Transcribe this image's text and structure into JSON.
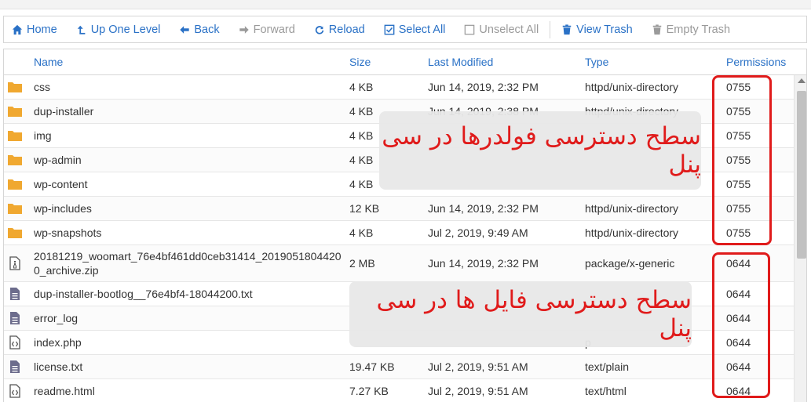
{
  "toolbar": {
    "home": "Home",
    "up_one_level": "Up One Level",
    "back": "Back",
    "forward": "Forward",
    "reload": "Reload",
    "select_all": "Select All",
    "unselect_all": "Unselect All",
    "view_trash": "View Trash",
    "empty_trash": "Empty Trash"
  },
  "columns": {
    "name": "Name",
    "size": "Size",
    "last_modified": "Last Modified",
    "type": "Type",
    "permissions": "Permissions"
  },
  "rows": [
    {
      "icon": "folder-icon",
      "name": "css",
      "size": "4 KB",
      "modified": "Jun 14, 2019, 2:32 PM",
      "type": "httpd/unix-directory",
      "perm": "0755"
    },
    {
      "icon": "folder-icon",
      "name": "dup-installer",
      "size": "4 KB",
      "modified": "Jun 14, 2019, 2:38 PM",
      "type": "httpd/unix-directory",
      "perm": "0755"
    },
    {
      "icon": "folder-icon",
      "name": "img",
      "size": "4 KB",
      "modified": "",
      "type": "",
      "perm": "0755"
    },
    {
      "icon": "folder-icon",
      "name": "wp-admin",
      "size": "4 KB",
      "modified": "",
      "type": "",
      "perm": "0755"
    },
    {
      "icon": "folder-icon",
      "name": "wp-content",
      "size": "4 KB",
      "modified": "",
      "type": "",
      "perm": "0755"
    },
    {
      "icon": "folder-icon",
      "name": "wp-includes",
      "size": "12 KB",
      "modified": "Jun 14, 2019, 2:32 PM",
      "type": "httpd/unix-directory",
      "perm": "0755"
    },
    {
      "icon": "folder-icon",
      "name": "wp-snapshots",
      "size": "4 KB",
      "modified": "Jul 2, 2019, 9:49 AM",
      "type": "httpd/unix-directory",
      "perm": "0755"
    },
    {
      "icon": "archive-icon",
      "name": "20181219_woomart_76e4bf461dd0ceb31414_2019051804420 0_archive.zip",
      "size": "2 MB",
      "modified": "Jun 14, 2019, 2:32 PM",
      "type": "package/x-generic",
      "perm": "0644"
    },
    {
      "icon": "text-file-icon",
      "name": "dup-installer-bootlog__76e4bf4-18044200.txt",
      "size": "",
      "modified": "",
      "type": "",
      "perm": "0644"
    },
    {
      "icon": "text-file-icon",
      "name": "error_log",
      "size": "",
      "modified": "",
      "type": "",
      "perm": "0644"
    },
    {
      "icon": "code-file-icon",
      "name": "index.php",
      "size": "",
      "modified": "",
      "type": "p",
      "perm": "0644"
    },
    {
      "icon": "text-file-icon",
      "name": "license.txt",
      "size": "19.47 KB",
      "modified": "Jul 2, 2019, 9:51 AM",
      "type": "text/plain",
      "perm": "0644"
    },
    {
      "icon": "code-file-icon",
      "name": "readme.html",
      "size": "7.27 KB",
      "modified": "Jul 2, 2019, 9:51 AM",
      "type": "text/html",
      "perm": "0644"
    }
  ],
  "annotations": {
    "folders_label": "سطح دسترسی فولدرها در سی پنل",
    "files_label": "سطح دسترسی  فایل ها در سی پنل",
    "highlight_color": "#e01b1b"
  },
  "colors": {
    "link": "#2a71c6",
    "folder": "#f0a830",
    "file_icon": "#6c6c8c"
  }
}
